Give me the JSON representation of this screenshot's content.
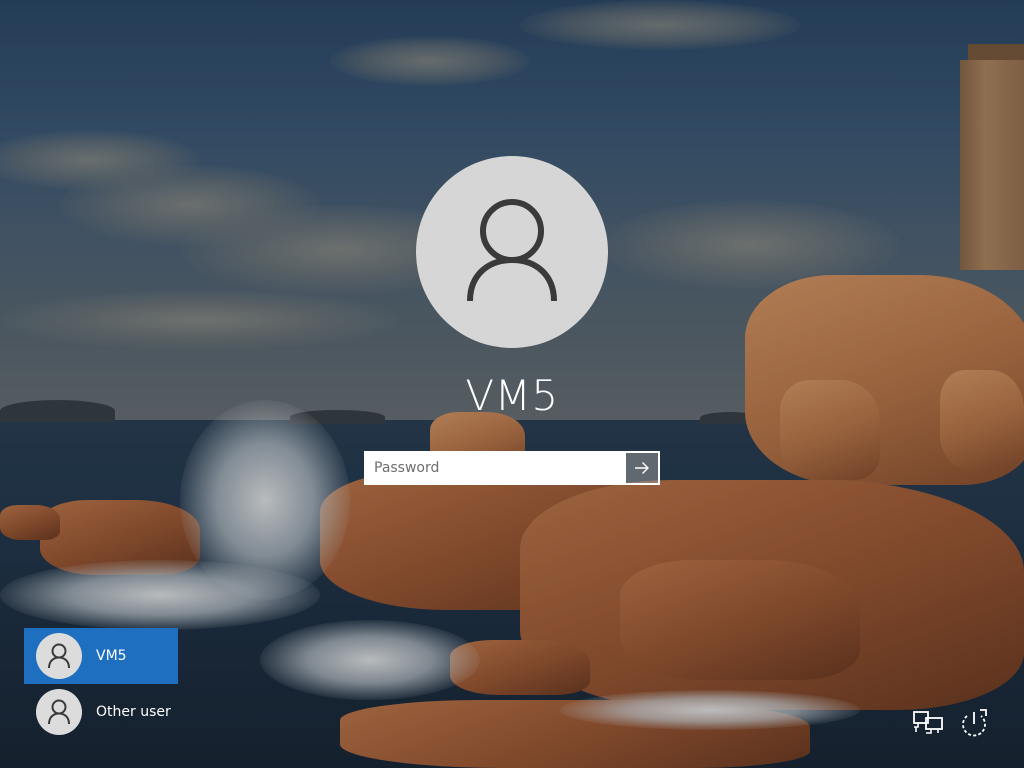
{
  "login": {
    "username": "VM5",
    "password_placeholder": "Password",
    "submit_icon": "arrow-right-icon",
    "avatar_icon": "user-icon"
  },
  "user_list": {
    "items": [
      {
        "label": "VM5",
        "selected": true,
        "icon": "user-icon"
      },
      {
        "label": "Other user",
        "selected": false,
        "icon": "user-icon"
      }
    ]
  },
  "system_icons": {
    "network": "network-icon",
    "power_options": "ease-of-access-power-icon"
  },
  "colors": {
    "selected_user_background": "#1e6fbf",
    "avatar_background": "#d6d6d6",
    "text": "#ffffff"
  }
}
